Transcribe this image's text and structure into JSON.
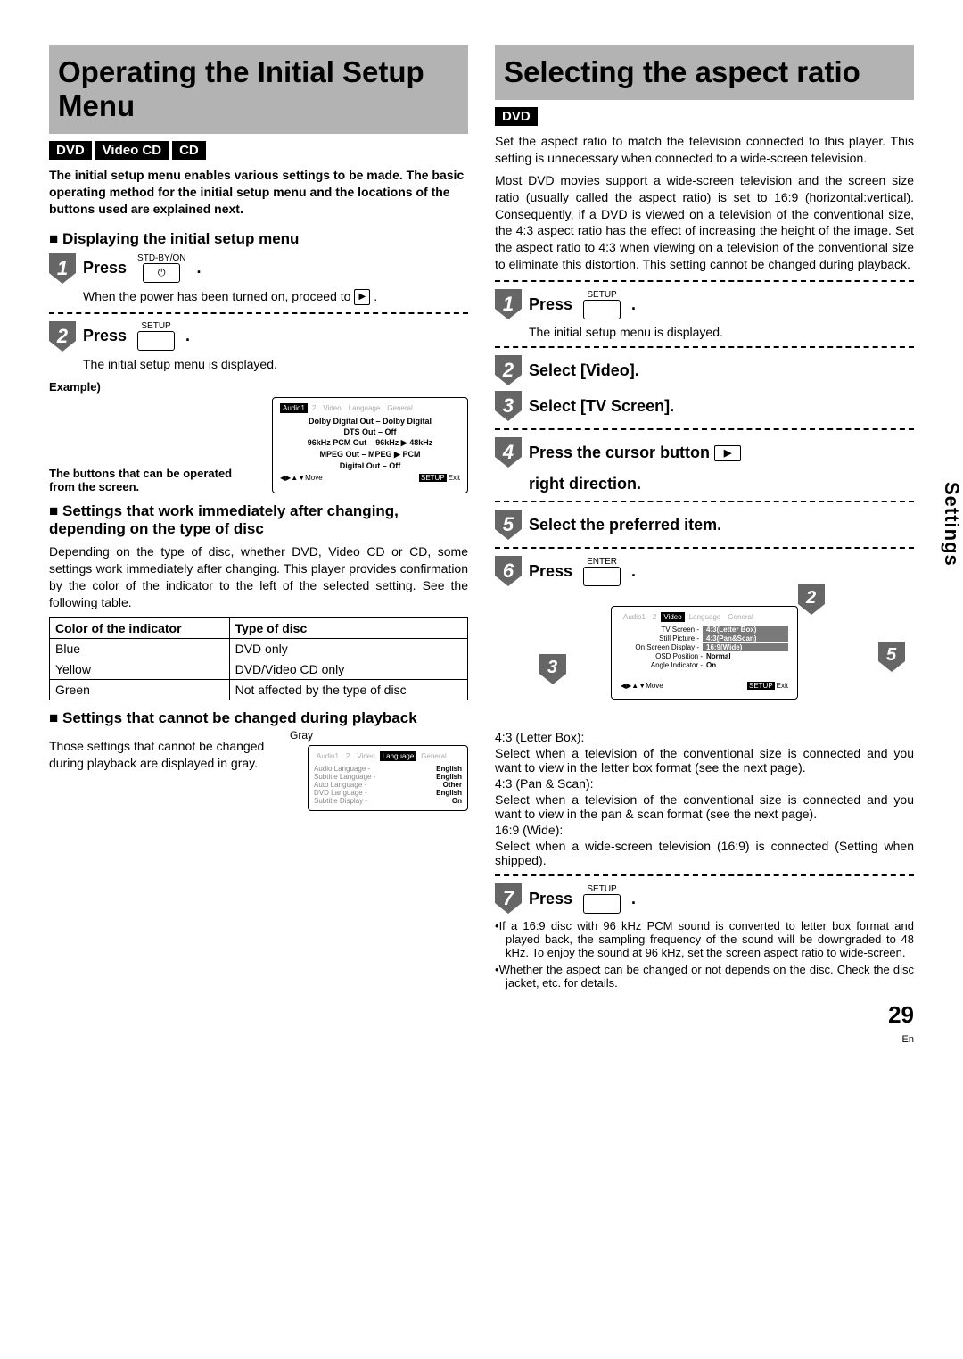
{
  "left": {
    "title": "Operating the Initial Setup Menu",
    "badges": [
      "DVD",
      "Video CD",
      "CD"
    ],
    "lead": "The initial setup menu enables various settings to be made. The basic operating method for the initial setup menu and the locations of the buttons used are explained next.",
    "sub_display": "Displaying the initial setup menu",
    "step1": {
      "action": "Press",
      "btn_label": "STD-BY/ON",
      "btn_glyph": "⏻",
      "period": ".",
      "desc_pre": "When the power has been turned on, proceed to ",
      "desc_post": "."
    },
    "step2": {
      "action": "Press",
      "btn_label": "SETUP",
      "period": ".",
      "desc": "The initial setup menu is displayed."
    },
    "example_label": "Example)",
    "osd1": {
      "tabs": [
        "Audio1",
        "2",
        "Video",
        "Language",
        "General"
      ],
      "lines": [
        "Dolby Digital Out – Dolby Digital",
        "DTS Out – Off",
        "96kHz PCM Out – 96kHz ▶ 48kHz",
        "MPEG Out – MPEG ▶ PCM",
        "Digital Out – Off"
      ],
      "footer_move": "◀▶▲▼Move",
      "footer_setup": "SETUP",
      "footer_exit": "Exit"
    },
    "osd1_note": "The buttons that can be operated from the screen.",
    "sub_settings_work": "Settings that work immediately after changing, depending on the type of disc",
    "settings_work_body": "Depending on the type of disc, whether DVD, Video CD or CD, some settings work immediately after changing.  This player provides confirmation by the color of the indicator to the left of the selected setting.  See the following table.",
    "table": {
      "h1": "Color of the indicator",
      "h2": "Type of disc",
      "r1c1": "Blue",
      "r1c2": "DVD only",
      "r2c1": "Yellow",
      "r2c2": "DVD/Video CD only",
      "r3c1": "Green",
      "r3c2": "Not affected by the type of disc"
    },
    "sub_cannot": "Settings that cannot be changed during playback",
    "cannot_body": "Those settings that cannot be changed during playback are displayed in gray.",
    "gray_label": "Gray",
    "osd2": {
      "tabs": [
        "Audio1",
        "2",
        "Video",
        "Language",
        "General"
      ],
      "rows": [
        {
          "k": "Audio Language -",
          "v": "English"
        },
        {
          "k": "Subtitle Language -",
          "v": "English"
        },
        {
          "k": "Auto Language -",
          "v": "Other"
        },
        {
          "k": "DVD Language -",
          "v": "English"
        },
        {
          "k": "Subtitle Display -",
          "v": "On"
        }
      ]
    }
  },
  "right": {
    "title": "Selecting the aspect ratio",
    "badges": [
      "DVD"
    ],
    "intro1": "Set the aspect ratio to match the television connected to this player. This setting is unnecessary when connected to a wide-screen television.",
    "intro2": "Most DVD movies support a wide-screen television and the screen size ratio (usually called the aspect ratio) is set to 16:9 (horizontal:vertical).  Consequently, if a DVD is viewed on a television of the conventional size, the 4:3 aspect ratio has the effect of increasing the height of the image.  Set the aspect ratio to 4:3 when viewing on a television of the conventional size to eliminate this distortion.  This setting cannot be changed during playback.",
    "step1": {
      "action": "Press",
      "btn_label": "SETUP",
      "period": ".",
      "desc": "The initial setup menu is displayed."
    },
    "step2": {
      "text": "Select [Video]."
    },
    "step3": {
      "text": "Select [TV Screen]."
    },
    "step4": {
      "pre": "Press the cursor button ",
      "post": " right direction."
    },
    "step5": {
      "text": "Select the preferred item."
    },
    "step6": {
      "action": "Press",
      "btn_label": "ENTER",
      "period": "."
    },
    "osd": {
      "tabs": [
        "Audio1",
        "2",
        "Video",
        "Language",
        "General"
      ],
      "rows": [
        {
          "k": "TV Screen -",
          "v": "4:3(Letter Box)",
          "hl": true
        },
        {
          "k": "Still Picture -",
          "v": "4:3(Pan&Scan)",
          "hlv": true
        },
        {
          "k": "On Screen Display -",
          "v": "16:9(Wide)",
          "hlv": true
        },
        {
          "k": "OSD Position -",
          "v": "Normal"
        },
        {
          "k": "Angle Indicator -",
          "v": "On"
        }
      ],
      "footer_move": "◀▶▲▼Move",
      "footer_setup": "SETUP",
      "footer_exit": "Exit"
    },
    "opt1_h": "4:3 (Letter Box):",
    "opt1_b": "Select when a television of the conventional size is connected and you want to view in the letter box format (see the next page).",
    "opt2_h": "4:3 (Pan & Scan):",
    "opt2_b": "Select when a television of the conventional size is connected and you want to view in the pan & scan format (see the next page).",
    "opt3_h": "16:9 (Wide):",
    "opt3_b": "Select when a wide-screen television (16:9) is connected (Setting when shipped).",
    "step7": {
      "action": "Press",
      "btn_label": "SETUP",
      "period": "."
    },
    "note1": "If a 16:9 disc with 96 kHz PCM sound is converted to letter box format and played back, the sampling frequency of the sound will be downgraded to 48 kHz.  To enjoy the sound at 96 kHz, set the screen aspect ratio to wide-screen.",
    "note2": "Whether the aspect can be changed or not depends on the disc.  Check the disc jacket, etc. for details.",
    "side_tab": "Settings",
    "page_num": "29",
    "page_num_sub": "En"
  }
}
